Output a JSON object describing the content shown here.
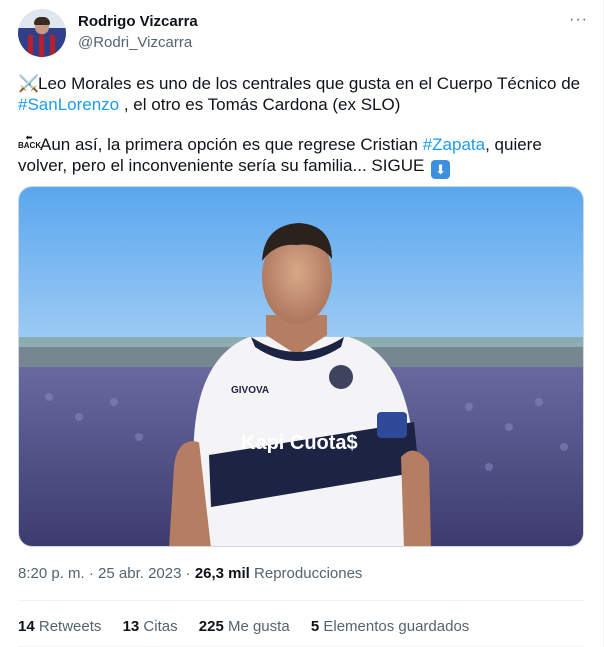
{
  "author": {
    "name": "Rodrigo Vizcarra",
    "handle": "@Rodri_Vizcarra"
  },
  "menu": {
    "more": "···"
  },
  "tweet": {
    "p1_emoji": "⚔️",
    "p1_a": "Leo Morales es uno de los centrales que gusta en el Cuerpo Técnico de ",
    "p1_tag": "#SanLorenzo",
    "p1_b": " , el otro es Tomás Cardona (ex SLO)",
    "p2_emoji": "BACK",
    "p2_a": "Aun así, la primera opción es que regrese Cristian ",
    "p2_tag": "#Zapata",
    "p2_b": ", quiere volver, pero el inconveniente sería su familia... SIGUE ",
    "p2_emoji_end": "⬇"
  },
  "media": {
    "shirt_brand": "Kapi Cuota$",
    "kit_brand": "GIVOVA"
  },
  "meta": {
    "time": "8:20 p. m.",
    "sep1": " · ",
    "date": "25 abr. 2023",
    "sep2": " · ",
    "views": "26,3 mil",
    "views_label": " Reproducciones"
  },
  "stats": [
    {
      "count": "14",
      "label": " Retweets"
    },
    {
      "count": "13",
      "label": " Citas"
    },
    {
      "count": "225",
      "label": " Me gusta"
    },
    {
      "count": "5",
      "label": " Elementos guardados"
    }
  ]
}
